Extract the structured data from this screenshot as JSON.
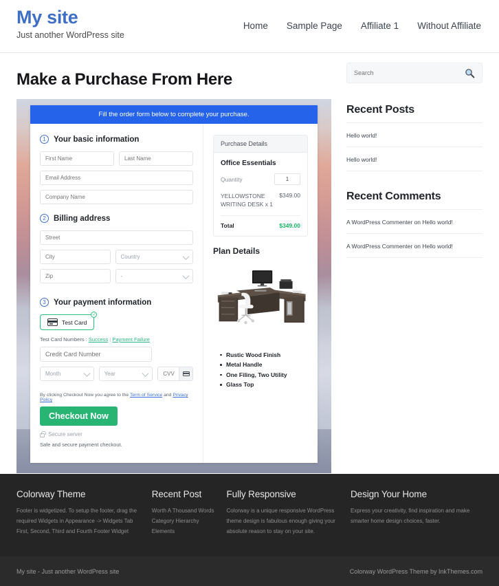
{
  "header": {
    "site_title": "My site",
    "tagline": "Just another WordPress site",
    "nav": [
      {
        "label": "Home"
      },
      {
        "label": "Sample Page"
      },
      {
        "label": "Affiliate 1"
      },
      {
        "label": "Without Affiliate"
      }
    ]
  },
  "main": {
    "page_title": "Make a Purchase From Here",
    "order_banner": "Fill the order form below to complete your purchase.",
    "steps": {
      "one_num": "1",
      "one_label": "Your basic information",
      "two_num": "2",
      "two_label": "Billing address",
      "three_num": "3",
      "three_label": "Your payment information"
    },
    "fields": {
      "first_name": "First Name",
      "last_name": "Last Name",
      "email": "Email Address",
      "company": "Company Name",
      "street": "Street",
      "city": "City",
      "country": "Country",
      "zip": "Zip",
      "state": "-",
      "credit_card_number": "Credit Card Number",
      "month": "Month",
      "year": "Year",
      "cvv": "CVV"
    },
    "payment": {
      "card_option_label": "Test Card",
      "test_card_prefix": "Test Card Numbers : ",
      "test_card_success": "Success",
      "test_card_separator": " | ",
      "test_card_failure": "Payment Failure",
      "terms_prefix": "By clicking Checkout Now you agree to the ",
      "terms_link1": "Term of Service",
      "terms_mid": " and ",
      "terms_link2": "Privacy Policy",
      "checkout_button": "Checkout Now",
      "secure_server": "Secure server",
      "safe_note": "Safe and secure payment checkout."
    },
    "purchase": {
      "box_title": "Purchase Details",
      "plan_name": "Office Essentials",
      "quantity_label": "Quantity",
      "quantity_value": "1",
      "item_name": "YELLOWSTONE WRITING DESK x 1",
      "item_price": "$349.00",
      "total_label": "Total",
      "total_value": "$349.00",
      "plan_details_title": "Plan Details",
      "features": [
        "Rustic Wood Finish",
        "Metal Handle",
        "One Filing, Two Utility",
        "Glass Top"
      ]
    }
  },
  "sidebar": {
    "search_placeholder": "Search",
    "search_value": "",
    "recent_posts_title": "Recent Posts",
    "recent_posts": [
      {
        "label": "Hello world!"
      },
      {
        "label": "Hello world!"
      }
    ],
    "recent_comments_title": "Recent Comments",
    "recent_comments": [
      {
        "label": "A WordPress Commenter on Hello world!"
      },
      {
        "label": "A WordPress Commenter on Hello world!"
      }
    ]
  },
  "footer": {
    "columns": [
      {
        "title": "Colorway Theme",
        "text": "Footer is widgetized. To setup the footer, drag the required Widgets in Appearance -> Widgets Tab First, Second, Third and Fourth Footer Widget"
      },
      {
        "title": "Recent Post",
        "items": [
          {
            "label": "Worth A Thousand Words"
          },
          {
            "label": "Category Hierarchy"
          },
          {
            "label": "Elements"
          }
        ]
      },
      {
        "title": "Fully Responsive",
        "text": "Colorway is a unique responsive WordPress theme design is fabulous enough giving your absolute reason to stay on your site."
      },
      {
        "title": "Design Your Home",
        "text": "Express your creativity, find inspiration and make smarter home design choices, faster."
      }
    ],
    "bottom_left": "My site - Just another WordPress site",
    "bottom_right": "Colorway WordPress Theme by InkThemes.com"
  },
  "colors": {
    "brand_blue": "#3f6fc4",
    "banner_blue": "#2563eb",
    "accent_green": "#28b473",
    "total_green": "#19b567",
    "footer_dark": "#252525"
  }
}
